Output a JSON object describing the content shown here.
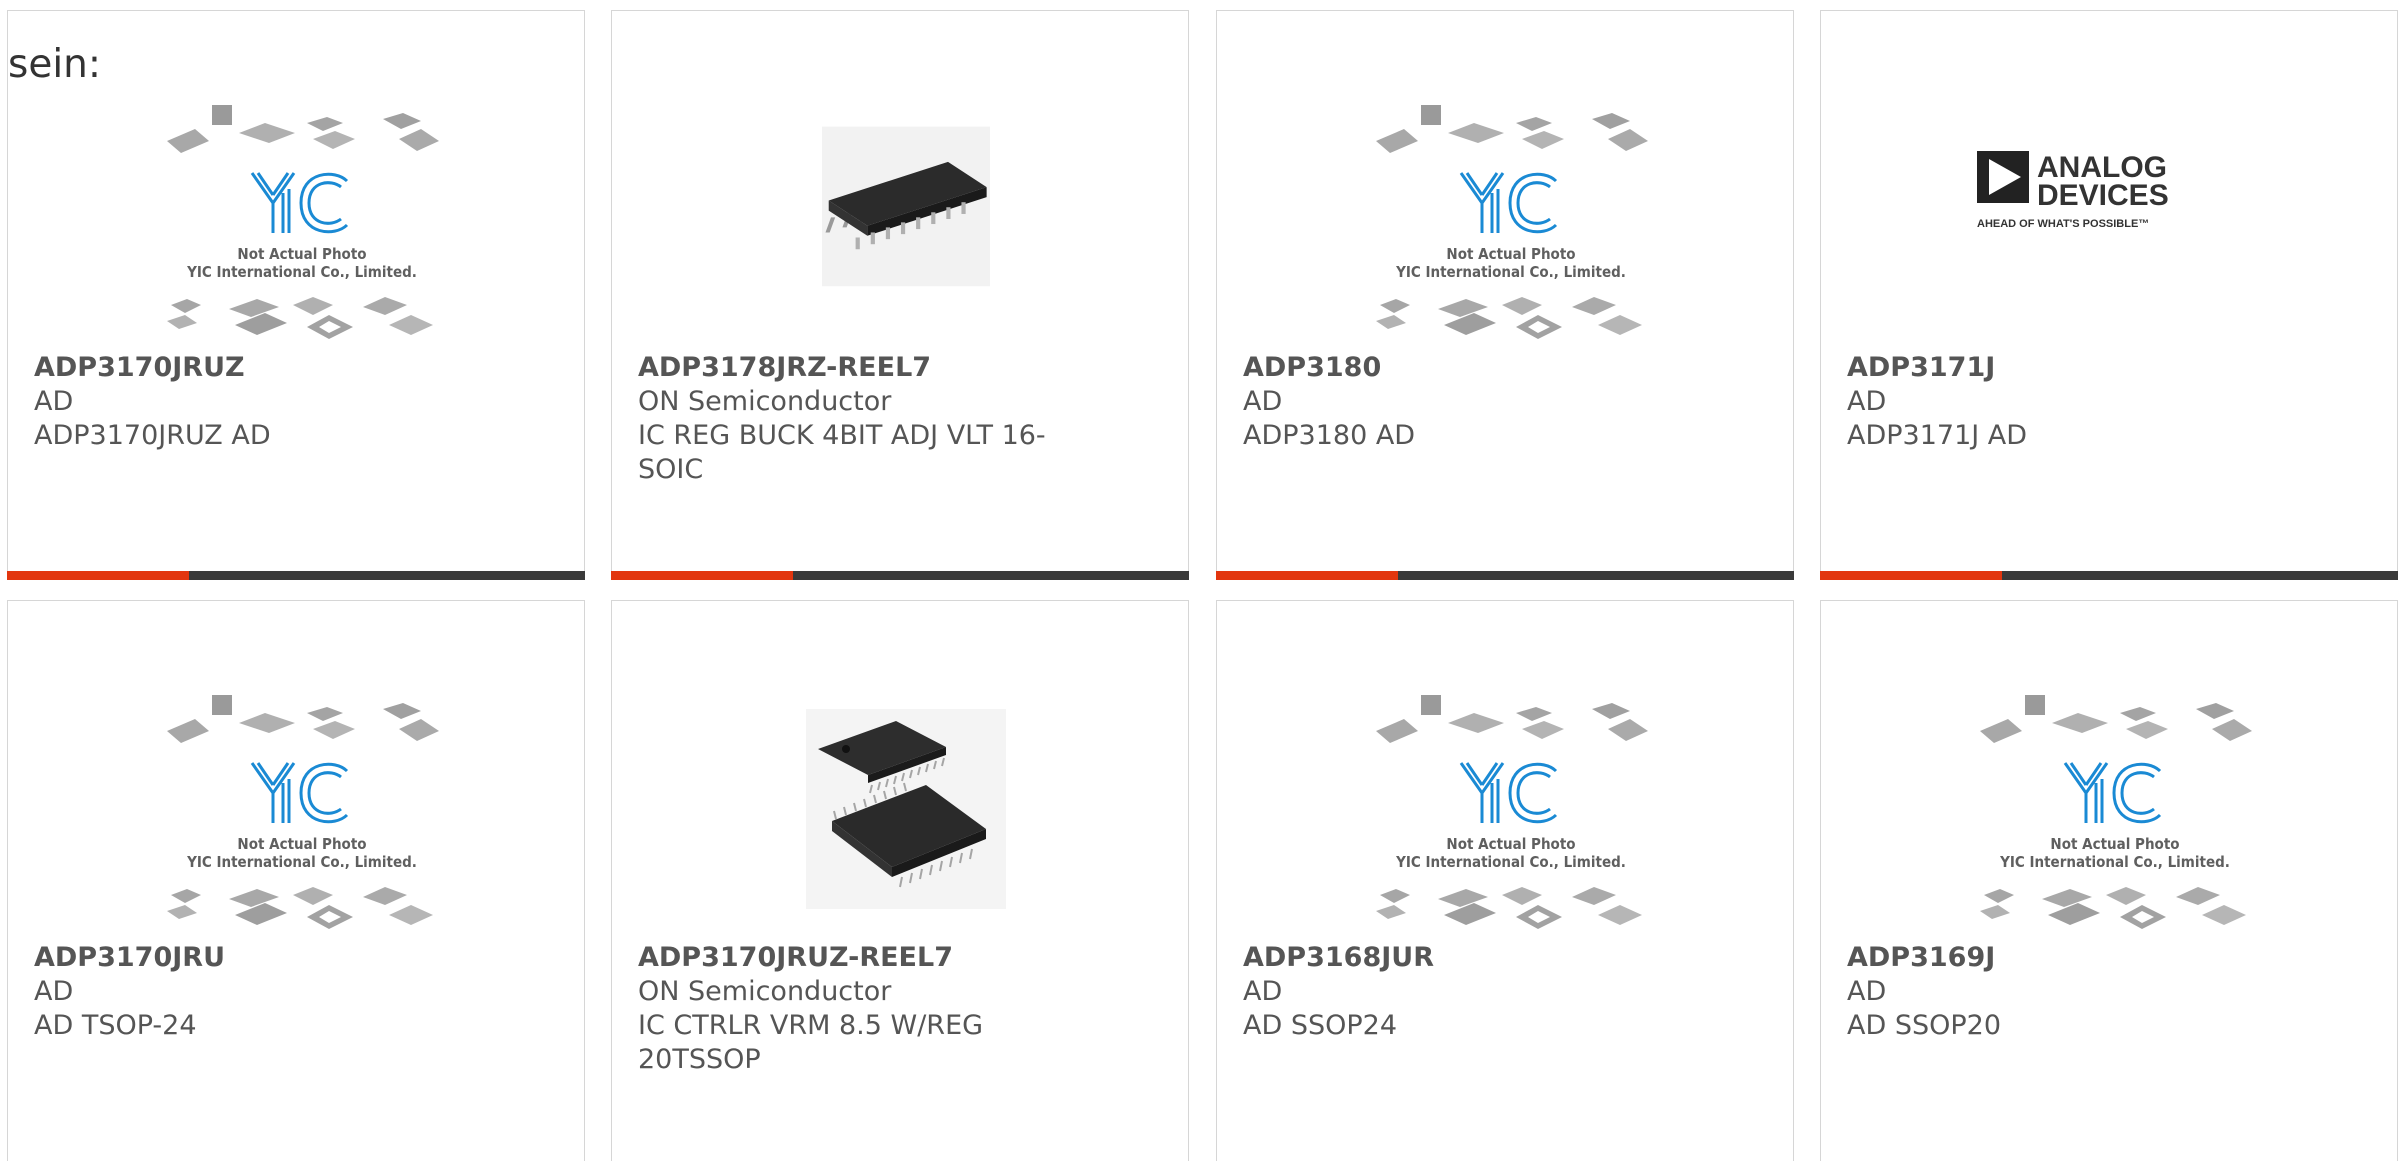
{
  "intro_text": "sein:",
  "placeholder": {
    "caption_line1": "Not Actual Photo",
    "caption_line2": "YIC International Co., Limited.",
    "logo_text": "YIC"
  },
  "analog_logo": {
    "line1": "ANALOG",
    "line2": "DEVICES",
    "tagline": "AHEAD OF WHAT'S POSSIBLE™"
  },
  "colors": {
    "accent_bar": "#e2360f",
    "dark_bar": "#3a3a3a",
    "yic_blue": "#1a8ad4"
  },
  "products": [
    {
      "part": "ADP3170JRUZ",
      "maker": "AD",
      "desc": "ADP3170JRUZ AD",
      "image": "yic-placeholder"
    },
    {
      "part": "ADP3178JRZ-REEL7",
      "maker": "ON Semiconductor",
      "desc": "IC REG BUCK 4BIT ADJ VLT 16-SOIC",
      "image": "soic-chip"
    },
    {
      "part": "ADP3180",
      "maker": "AD",
      "desc": "ADP3180 AD",
      "image": "yic-placeholder"
    },
    {
      "part": "ADP3171J",
      "maker": "AD",
      "desc": "ADP3171J AD",
      "image": "analog-devices-logo"
    },
    {
      "part": "ADP3170JRU",
      "maker": "AD",
      "desc": "AD TSOP-24",
      "image": "yic-placeholder"
    },
    {
      "part": "ADP3170JRUZ-REEL7",
      "maker": "ON Semiconductor",
      "desc": "IC CTRLR VRM 8.5 W/REG 20TSSOP",
      "image": "tssop-chips"
    },
    {
      "part": "ADP3168JUR",
      "maker": "AD",
      "desc": "AD SSOP24",
      "image": "yic-placeholder"
    },
    {
      "part": "ADP3169J",
      "maker": "AD",
      "desc": "AD SSOP20",
      "image": "yic-placeholder"
    }
  ]
}
